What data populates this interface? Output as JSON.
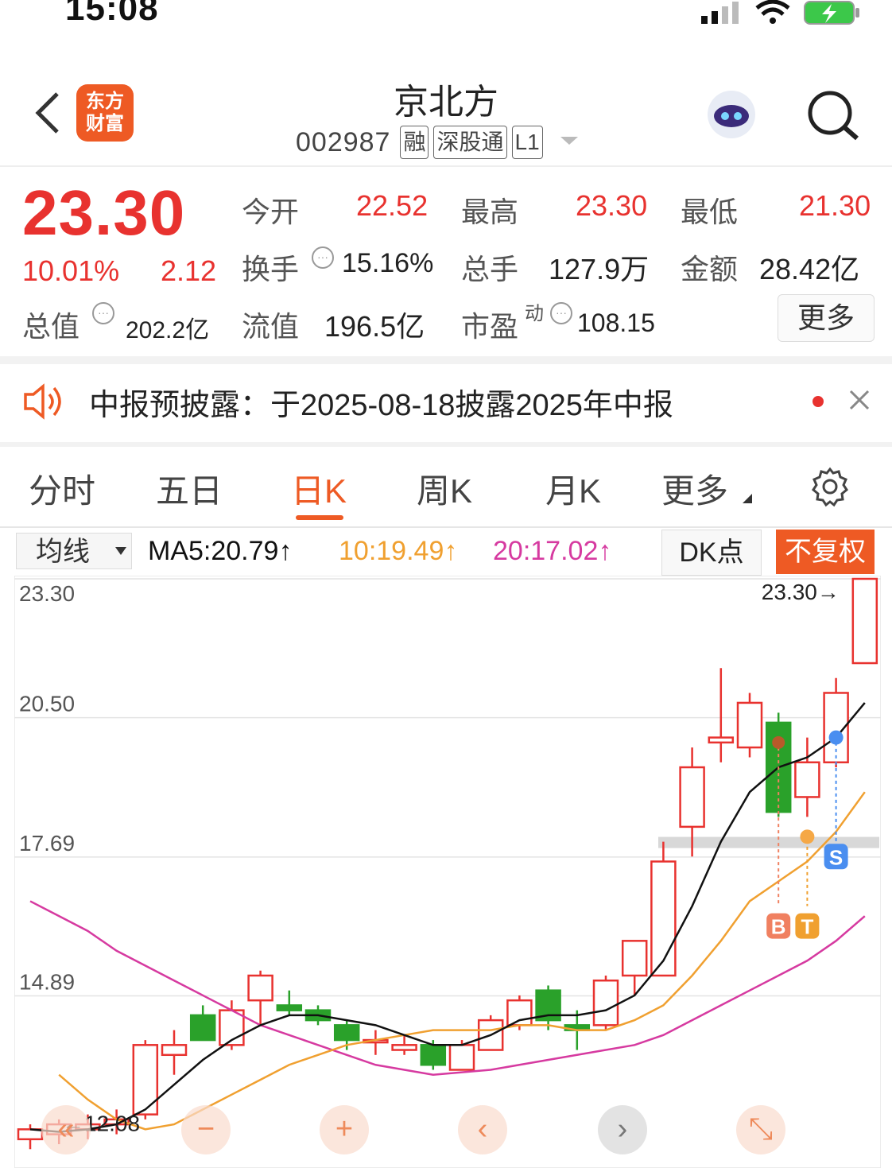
{
  "status": {
    "time": "15:08"
  },
  "header": {
    "logo_line1": "东方",
    "logo_line2": "财富",
    "name": "京北方",
    "code": "002987",
    "tags": [
      "融",
      "深股通",
      "L1"
    ]
  },
  "quote": {
    "price": "23.30",
    "change_pct": "10.01%",
    "change_amt": "2.12",
    "labels": {
      "open": "今开",
      "high": "最高",
      "low": "最低",
      "turnover": "换手",
      "volume": "总手",
      "amount": "金额",
      "mktcap": "总值",
      "float_cap": "流值",
      "pe": "市盈"
    },
    "pe_sup": "动",
    "open": "22.52",
    "high": "23.30",
    "low": "21.30",
    "turnover": "15.16%",
    "volume": "127.9万",
    "amount": "28.42亿",
    "mktcap": "202.2亿",
    "float_cap": "196.5亿",
    "pe": "108.15",
    "more": "更多"
  },
  "notice": {
    "text": "中报预披露：于2025-08-18披露2025年中报"
  },
  "tabs": [
    "分时",
    "五日",
    "日K",
    "周K",
    "月K",
    "更多"
  ],
  "active_tab": "日K",
  "ma_bar": {
    "select": "均线",
    "ma5": "MA5:20.79↑",
    "ma10": "10:19.49↑",
    "ma20": "20:17.02↑",
    "dk": "DK点",
    "fq": "不复权"
  },
  "colors": {
    "up": "#e8322f",
    "down": "#2aa12a",
    "ma5": "#111111",
    "ma10": "#f0a030",
    "ma20": "#d63aa0",
    "accent": "#ee5a24"
  },
  "chart_data": {
    "type": "candlestick",
    "y_ticks": [
      "23.30",
      "20.50",
      "17.69",
      "14.89"
    ],
    "ylim": [
      11.5,
      23.3
    ],
    "last_label": "23.30",
    "low_label": "12.08",
    "markers": [
      "B",
      "T",
      "S"
    ],
    "candles": [
      {
        "o": 12.0,
        "h": 12.3,
        "l": 11.8,
        "c": 12.2
      },
      {
        "o": 12.1,
        "h": 12.4,
        "l": 11.9,
        "c": 12.3
      },
      {
        "o": 12.2,
        "h": 12.5,
        "l": 12.0,
        "c": 12.3
      },
      {
        "o": 12.3,
        "h": 12.6,
        "l": 12.1,
        "c": 12.4
      },
      {
        "o": 12.5,
        "h": 14.0,
        "l": 12.4,
        "c": 13.9
      },
      {
        "o": 13.7,
        "h": 14.2,
        "l": 13.3,
        "c": 13.9
      },
      {
        "o": 14.5,
        "h": 14.7,
        "l": 14.0,
        "c": 14.0
      },
      {
        "o": 13.9,
        "h": 14.8,
        "l": 13.8,
        "c": 14.6
      },
      {
        "o": 14.8,
        "h": 15.4,
        "l": 14.3,
        "c": 15.3
      },
      {
        "o": 14.7,
        "h": 15.0,
        "l": 14.5,
        "c": 14.6
      },
      {
        "o": 14.6,
        "h": 14.7,
        "l": 14.3,
        "c": 14.4
      },
      {
        "o": 14.3,
        "h": 14.4,
        "l": 13.8,
        "c": 14.0
      },
      {
        "o": 14.0,
        "h": 14.2,
        "l": 13.7,
        "c": 14.0
      },
      {
        "o": 13.8,
        "h": 14.1,
        "l": 13.7,
        "c": 13.9
      },
      {
        "o": 13.9,
        "h": 14.0,
        "l": 13.4,
        "c": 13.5
      },
      {
        "o": 13.4,
        "h": 14.0,
        "l": 13.4,
        "c": 13.9
      },
      {
        "o": 13.8,
        "h": 14.5,
        "l": 13.8,
        "c": 14.4
      },
      {
        "o": 14.3,
        "h": 14.9,
        "l": 14.2,
        "c": 14.8
      },
      {
        "o": 15.0,
        "h": 15.1,
        "l": 14.2,
        "c": 14.4
      },
      {
        "o": 14.3,
        "h": 14.6,
        "l": 13.8,
        "c": 14.2
      },
      {
        "o": 14.3,
        "h": 15.3,
        "l": 14.2,
        "c": 15.2
      },
      {
        "o": 15.3,
        "h": 16.0,
        "l": 14.9,
        "c": 16.0
      },
      {
        "o": 15.3,
        "h": 18.0,
        "l": 15.3,
        "c": 17.6
      },
      {
        "o": 18.3,
        "h": 19.9,
        "l": 17.7,
        "c": 19.5
      },
      {
        "o": 20.0,
        "h": 21.5,
        "l": 19.6,
        "c": 20.1
      },
      {
        "o": 19.9,
        "h": 21.0,
        "l": 19.7,
        "c": 20.8
      },
      {
        "o": 20.4,
        "h": 20.6,
        "l": 18.5,
        "c": 18.6
      },
      {
        "o": 18.9,
        "h": 20.1,
        "l": 18.5,
        "c": 19.6
      },
      {
        "o": 19.6,
        "h": 21.3,
        "l": 19.5,
        "c": 21.0
      },
      {
        "o": 21.6,
        "h": 23.3,
        "l": 21.6,
        "c": 23.3
      }
    ],
    "ma5": [
      12.2,
      12.15,
      12.2,
      12.3,
      12.6,
      13.1,
      13.6,
      14.0,
      14.3,
      14.5,
      14.5,
      14.4,
      14.3,
      14.1,
      13.9,
      13.9,
      14.1,
      14.4,
      14.5,
      14.5,
      14.6,
      14.9,
      15.6,
      16.7,
      18.0,
      19.0,
      19.5,
      19.7,
      20.1,
      20.8
    ],
    "ma10": [
      null,
      13.3,
      12.8,
      12.4,
      12.2,
      12.3,
      12.6,
      12.9,
      13.2,
      13.5,
      13.7,
      13.9,
      14.0,
      14.1,
      14.2,
      14.2,
      14.2,
      14.3,
      14.3,
      14.2,
      14.2,
      14.4,
      14.7,
      15.3,
      16.0,
      16.8,
      17.2,
      17.6,
      18.2,
      19.0
    ],
    "ma20": [
      16.8,
      16.5,
      16.2,
      15.8,
      15.5,
      15.2,
      14.9,
      14.6,
      14.3,
      14.1,
      13.9,
      13.7,
      13.5,
      13.4,
      13.3,
      13.35,
      13.4,
      13.5,
      13.6,
      13.7,
      13.8,
      13.9,
      14.1,
      14.4,
      14.7,
      15.0,
      15.3,
      15.6,
      16.0,
      16.5
    ]
  }
}
